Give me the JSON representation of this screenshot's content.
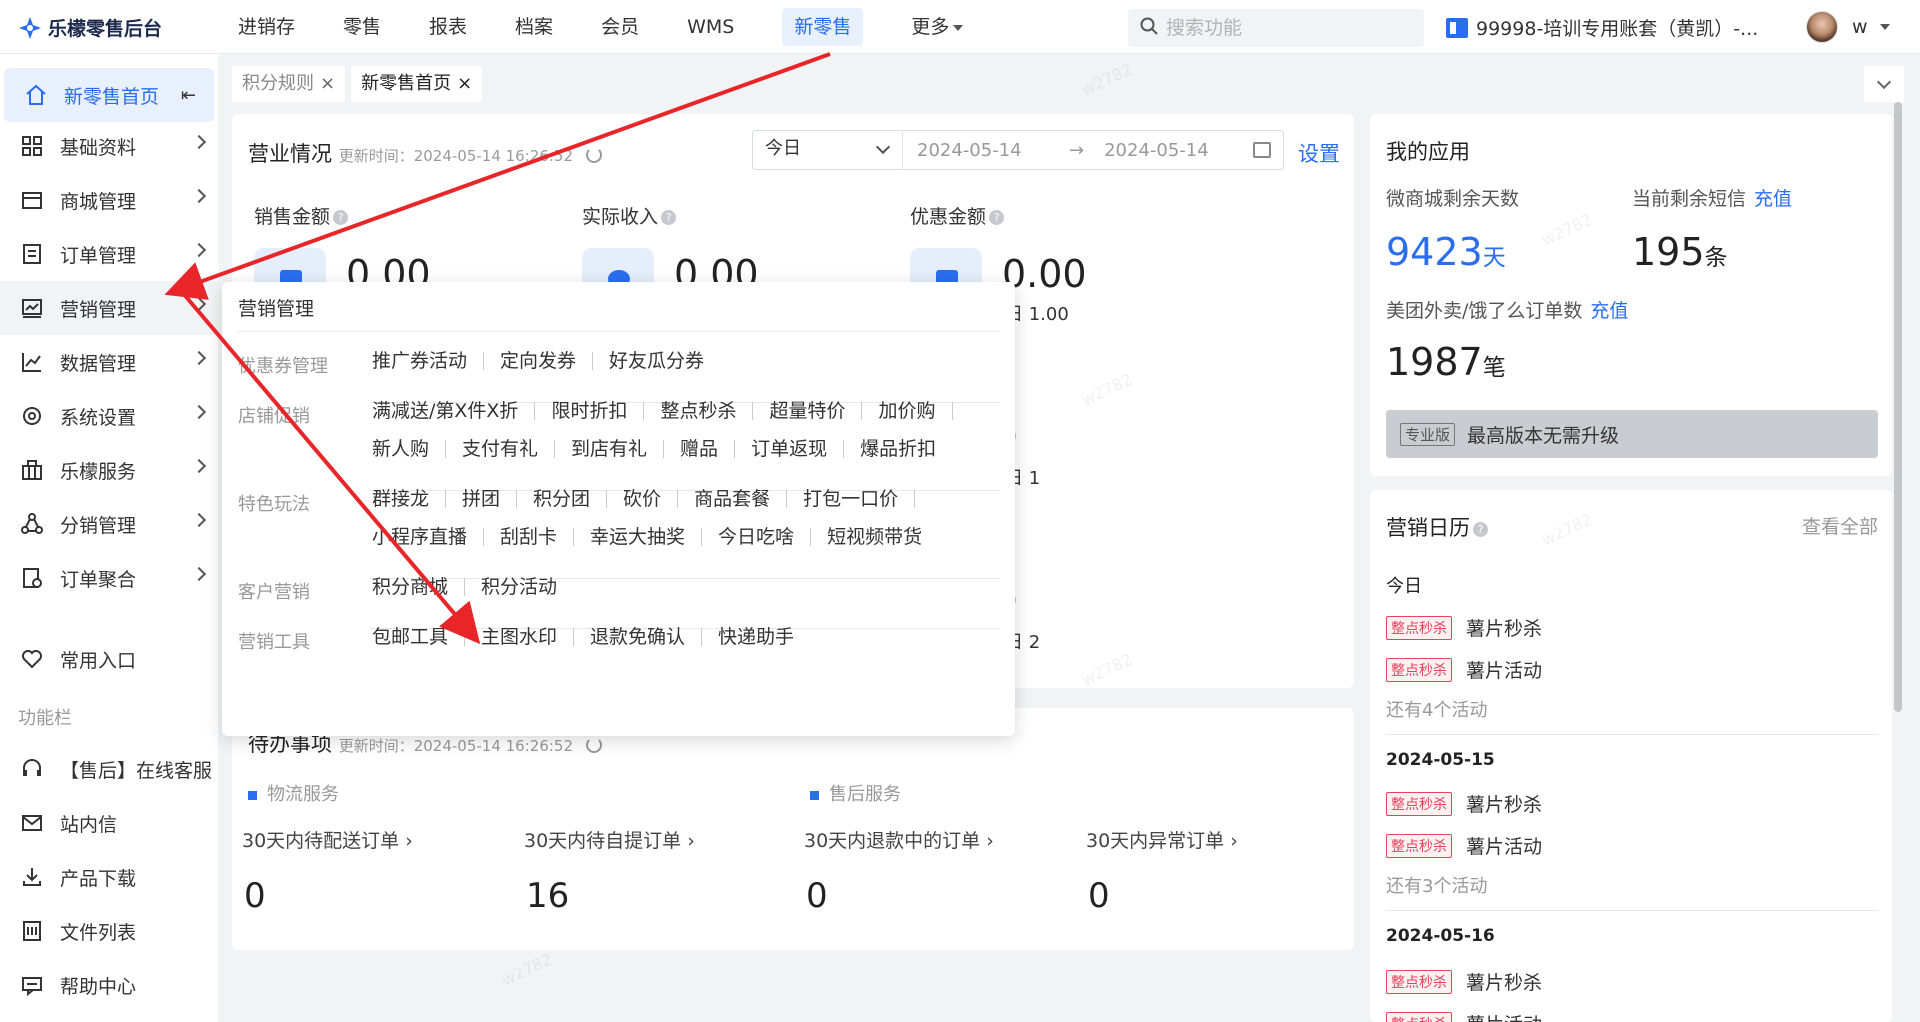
{
  "app": {
    "logo_text": "乐檬零售后台"
  },
  "topnav": {
    "items": [
      "进销存",
      "零售",
      "报表",
      "档案",
      "会员",
      "WMS",
      "新零售",
      "更多"
    ],
    "active_index": 6
  },
  "search": {
    "placeholder": "搜索功能"
  },
  "account": {
    "label": "99998-培训专用账套（黄凯）-...",
    "user": "w"
  },
  "sidebar": {
    "home": "新零售首页",
    "items": [
      {
        "label": "基础资料",
        "icon": "grid-icon"
      },
      {
        "label": "商城管理",
        "icon": "store-icon"
      },
      {
        "label": "订单管理",
        "icon": "order-icon"
      },
      {
        "label": "营销管理",
        "icon": "marketing-icon"
      },
      {
        "label": "数据管理",
        "icon": "chart-icon"
      },
      {
        "label": "系统设置",
        "icon": "settings-icon"
      },
      {
        "label": "乐檬服务",
        "icon": "service-icon"
      },
      {
        "label": "分销管理",
        "icon": "distribution-icon"
      },
      {
        "label": "订单聚合",
        "icon": "aggregate-icon"
      }
    ],
    "common_entry": "常用入口",
    "function_bar": "功能栏",
    "tools": [
      {
        "label": "【售后】在线客服",
        "icon": "headset-icon"
      },
      {
        "label": "站内信",
        "icon": "mail-icon"
      },
      {
        "label": "产品下载",
        "icon": "download-icon"
      },
      {
        "label": "文件列表",
        "icon": "file-list-icon"
      },
      {
        "label": "帮助中心",
        "icon": "help-icon"
      }
    ]
  },
  "tabs": [
    {
      "label": "积分规则"
    },
    {
      "label": "新零售首页"
    }
  ],
  "business": {
    "title": "营业情况",
    "updated": "更新时间：2024-05-14 16:26:52",
    "range_select": "今日",
    "date_start": "2024-05-14",
    "date_end": "2024-05-14",
    "settings": "设置",
    "metrics": [
      {
        "label": "销售金额",
        "value": "0.00",
        "sub": ""
      },
      {
        "label": "实际收入",
        "value": "0.00",
        "sub": ""
      },
      {
        "label": "优惠金额",
        "value": "0.00",
        "sub": "日 1.00"
      }
    ],
    "row2_subs": [
      "日 1",
      "日 2"
    ]
  },
  "todo": {
    "title": "待办事项",
    "updated": "更新时间：2024-05-14 16:26:52",
    "sections": [
      "物流服务",
      "售后服务"
    ],
    "items": [
      {
        "label": "30天内待配送订单",
        "value": "0"
      },
      {
        "label": "30天内待自提订单",
        "value": "16"
      },
      {
        "label": "30天内退款中的订单",
        "value": "0"
      },
      {
        "label": "30天内异常订单",
        "value": "0"
      }
    ]
  },
  "my_apps": {
    "title": "我的应用",
    "mall_days_label": "微商城剩余天数",
    "mall_days": "9423",
    "mall_days_unit": "天",
    "sms_label": "当前剩余短信",
    "sms_recharge": "充值",
    "sms_count": "195",
    "sms_unit": "条",
    "takeout_label": "美团外卖/饿了么订单数",
    "takeout_recharge": "充值",
    "takeout_count": "1987",
    "takeout_unit": "笔",
    "edition_tag": "专业版",
    "edition_text": "最高版本无需升级"
  },
  "calendar": {
    "title": "营销日历",
    "view_all": "查看全部",
    "days": [
      {
        "date": "今日",
        "events": [
          {
            "badge": "整点秒杀",
            "name": "薯片秒杀"
          },
          {
            "badge": "整点秒杀",
            "name": "薯片活动"
          }
        ],
        "more": "还有4个活动"
      },
      {
        "date": "2024-05-15",
        "events": [
          {
            "badge": "整点秒杀",
            "name": "薯片秒杀"
          },
          {
            "badge": "整点秒杀",
            "name": "薯片活动"
          }
        ],
        "more": "还有3个活动"
      },
      {
        "date": "2024-05-16",
        "events": [
          {
            "badge": "整点秒杀",
            "name": "薯片秒杀"
          },
          {
            "badge": "整点秒杀",
            "name": "薯片活动"
          }
        ],
        "more": ""
      }
    ]
  },
  "popover": {
    "title": "营销管理",
    "groups": [
      {
        "category": "优惠券管理",
        "rows": [
          [
            "推广券活动",
            "定向发券",
            "好友瓜分券"
          ]
        ]
      },
      {
        "category": "店铺促销",
        "rows": [
          [
            "满减送/第X件X折",
            "限时折扣",
            "整点秒杀",
            "超量特价",
            "加价购"
          ],
          [
            "新人购",
            "支付有礼",
            "到店有礼",
            "赠品",
            "订单返现",
            "爆品折扣"
          ]
        ]
      },
      {
        "category": "特色玩法",
        "rows": [
          [
            "群接龙",
            "拼团",
            "积分团",
            "砍价",
            "商品套餐",
            "打包一口价"
          ],
          [
            "小程序直播",
            "刮刮卡",
            "幸运大抽奖",
            "今日吃啥",
            "短视频带货"
          ]
        ]
      },
      {
        "category": "客户营销",
        "rows": [
          [
            "积分商城",
            "积分活动"
          ]
        ]
      },
      {
        "category": "营销工具",
        "rows": [
          [
            "包邮工具",
            "主图水印",
            "退款免确认",
            "快递助手"
          ]
        ]
      }
    ]
  },
  "watermark": "w2782",
  "colors": {
    "accent": "#2a6ef0",
    "annotation_arrow": "#e8262a",
    "badge_red": "#e8425c"
  }
}
